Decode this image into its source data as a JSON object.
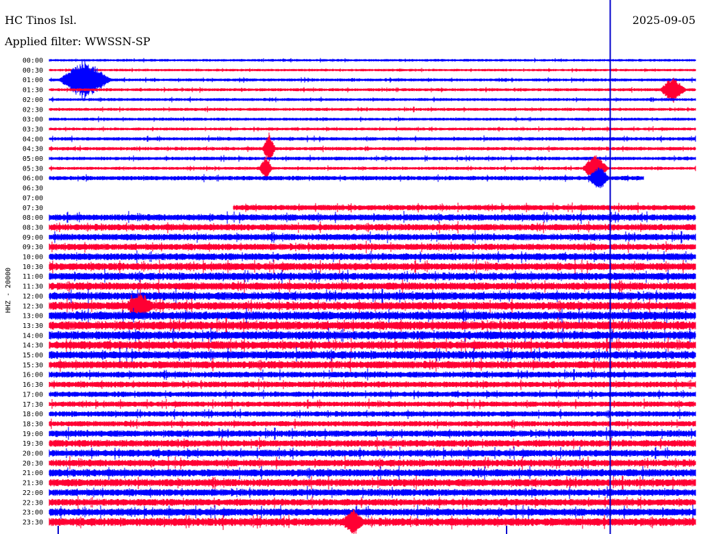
{
  "header": {
    "station": "HC Tinos Isl.",
    "date": "2025-09-05",
    "filter": "Applied filter: WWSSN-SP"
  },
  "chart_data": {
    "type": "line",
    "title": "HC Tinos Isl.",
    "subtitle": "Applied filter: WWSSN-SP",
    "ylabel": "HHZ - 20000",
    "xlabel": "",
    "colors": [
      "#0000ff",
      "#ff0033"
    ],
    "cursor_color": "#0000cc",
    "grid": false,
    "rows": [
      {
        "label": "00:00",
        "color": "#0000ff",
        "present": [
          0,
          1
        ],
        "amp": 0.25
      },
      {
        "label": "00:30",
        "color": "#ff0033",
        "present": [
          0,
          1
        ],
        "amp": 0.25
      },
      {
        "label": "01:00",
        "color": "#0000ff",
        "present": [
          0,
          1
        ],
        "amp": 0.3
      },
      {
        "label": "01:30",
        "color": "#ff0033",
        "present": [
          0,
          1
        ],
        "amp": 0.3
      },
      {
        "label": "02:00",
        "color": "#0000ff",
        "present": [
          0,
          1
        ],
        "amp": 0.3
      },
      {
        "label": "02:30",
        "color": "#ff0033",
        "present": [
          0,
          1
        ],
        "amp": 0.3
      },
      {
        "label": "03:00",
        "color": "#0000ff",
        "present": [
          0,
          1
        ],
        "amp": 0.3
      },
      {
        "label": "03:30",
        "color": "#ff0033",
        "present": [
          0,
          1
        ],
        "amp": 0.3
      },
      {
        "label": "04:00",
        "color": "#0000ff",
        "present": [
          0,
          1
        ],
        "amp": 0.35
      },
      {
        "label": "04:30",
        "color": "#ff0033",
        "present": [
          0,
          1
        ],
        "amp": 0.35
      },
      {
        "label": "05:00",
        "color": "#0000ff",
        "present": [
          0,
          1
        ],
        "amp": 0.35
      },
      {
        "label": "05:30",
        "color": "#ff0033",
        "present": [
          0,
          1
        ],
        "amp": 0.3
      },
      {
        "label": "06:00",
        "color": "#0000ff",
        "present": [
          0,
          0.92
        ],
        "amp": 0.45
      },
      {
        "label": "06:30",
        "color": "#ff0033",
        "present": [],
        "amp": 0
      },
      {
        "label": "07:00",
        "color": "#0000ff",
        "present": [],
        "amp": 0
      },
      {
        "label": "07:30",
        "color": "#ff0033",
        "present": [
          0.285,
          1
        ],
        "amp": 0.55
      },
      {
        "label": "08:00",
        "color": "#0000ff",
        "present": [
          0,
          1
        ],
        "amp": 0.65
      },
      {
        "label": "08:30",
        "color": "#ff0033",
        "present": [
          0,
          1
        ],
        "amp": 0.65
      },
      {
        "label": "09:00",
        "color": "#0000ff",
        "present": [
          0,
          1
        ],
        "amp": 0.65
      },
      {
        "label": "09:30",
        "color": "#ff0033",
        "present": [
          0,
          1
        ],
        "amp": 0.65
      },
      {
        "label": "10:00",
        "color": "#0000ff",
        "present": [
          0,
          1
        ],
        "amp": 0.7
      },
      {
        "label": "10:30",
        "color": "#ff0033",
        "present": [
          0,
          1
        ],
        "amp": 0.75
      },
      {
        "label": "11:00",
        "color": "#0000ff",
        "present": [
          0,
          1
        ],
        "amp": 0.75
      },
      {
        "label": "11:30",
        "color": "#ff0033",
        "present": [
          0,
          1
        ],
        "amp": 0.75
      },
      {
        "label": "12:00",
        "color": "#0000ff",
        "present": [
          0,
          1
        ],
        "amp": 0.8
      },
      {
        "label": "12:30",
        "color": "#ff0033",
        "present": [
          0,
          1
        ],
        "amp": 0.8
      },
      {
        "label": "13:00",
        "color": "#0000ff",
        "present": [
          0,
          1
        ],
        "amp": 0.85
      },
      {
        "label": "13:30",
        "color": "#ff0033",
        "present": [
          0,
          1
        ],
        "amp": 0.85
      },
      {
        "label": "14:00",
        "color": "#0000ff",
        "present": [
          0,
          1
        ],
        "amp": 0.85
      },
      {
        "label": "14:30",
        "color": "#ff0033",
        "present": [
          0,
          1
        ],
        "amp": 0.8
      },
      {
        "label": "15:00",
        "color": "#0000ff",
        "present": [
          0,
          1
        ],
        "amp": 0.8
      },
      {
        "label": "15:30",
        "color": "#ff0033",
        "present": [
          0,
          1
        ],
        "amp": 0.75
      },
      {
        "label": "16:00",
        "color": "#0000ff",
        "present": [
          0,
          1
        ],
        "amp": 0.6
      },
      {
        "label": "16:30",
        "color": "#ff0033",
        "present": [
          0,
          1
        ],
        "amp": 0.6
      },
      {
        "label": "17:00",
        "color": "#0000ff",
        "present": [
          0,
          1
        ],
        "amp": 0.55
      },
      {
        "label": "17:30",
        "color": "#ff0033",
        "present": [
          0,
          1
        ],
        "amp": 0.55
      },
      {
        "label": "18:00",
        "color": "#0000ff",
        "present": [
          0,
          1
        ],
        "amp": 0.55
      },
      {
        "label": "18:30",
        "color": "#ff0033",
        "present": [
          0,
          1
        ],
        "amp": 0.55
      },
      {
        "label": "19:00",
        "color": "#0000ff",
        "present": [
          0,
          1
        ],
        "amp": 0.65
      },
      {
        "label": "19:30",
        "color": "#ff0033",
        "present": [
          0,
          1
        ],
        "amp": 0.7
      },
      {
        "label": "20:00",
        "color": "#0000ff",
        "present": [
          0,
          1
        ],
        "amp": 0.7
      },
      {
        "label": "20:30",
        "color": "#ff0033",
        "present": [
          0,
          1
        ],
        "amp": 0.7
      },
      {
        "label": "21:00",
        "color": "#0000ff",
        "present": [
          0,
          1
        ],
        "amp": 0.75
      },
      {
        "label": "21:30",
        "color": "#ff0033",
        "present": [
          0,
          1
        ],
        "amp": 0.75
      },
      {
        "label": "22:00",
        "color": "#0000ff",
        "present": [
          0,
          1
        ],
        "amp": 0.7
      },
      {
        "label": "22:30",
        "color": "#ff0033",
        "present": [
          0,
          1
        ],
        "amp": 0.7
      },
      {
        "label": "23:00",
        "color": "#0000ff",
        "present": [
          0,
          1
        ],
        "amp": 0.75
      },
      {
        "label": "23:30",
        "color": "#ff0033",
        "present": [
          0,
          1
        ],
        "amp": 0.8
      }
    ],
    "events": [
      {
        "row": 2,
        "x": 0.055,
        "amp": 2.2,
        "width": 0.04
      },
      {
        "row": 3,
        "x": 0.965,
        "amp": 1.4,
        "width": 0.02
      },
      {
        "row": 9,
        "x": 0.34,
        "amp": 1.6,
        "width": 0.01
      },
      {
        "row": 11,
        "x": 0.335,
        "amp": 1.2,
        "width": 0.01
      },
      {
        "row": 11,
        "x": 0.845,
        "amp": 1.5,
        "width": 0.02
      },
      {
        "row": 12,
        "x": 0.85,
        "amp": 1.3,
        "width": 0.015
      },
      {
        "row": 25,
        "x": 0.14,
        "amp": 1.2,
        "width": 0.02
      },
      {
        "row": 47,
        "x": 0.47,
        "amp": 1.3,
        "width": 0.015
      }
    ],
    "cursor_x": 0.868
  }
}
